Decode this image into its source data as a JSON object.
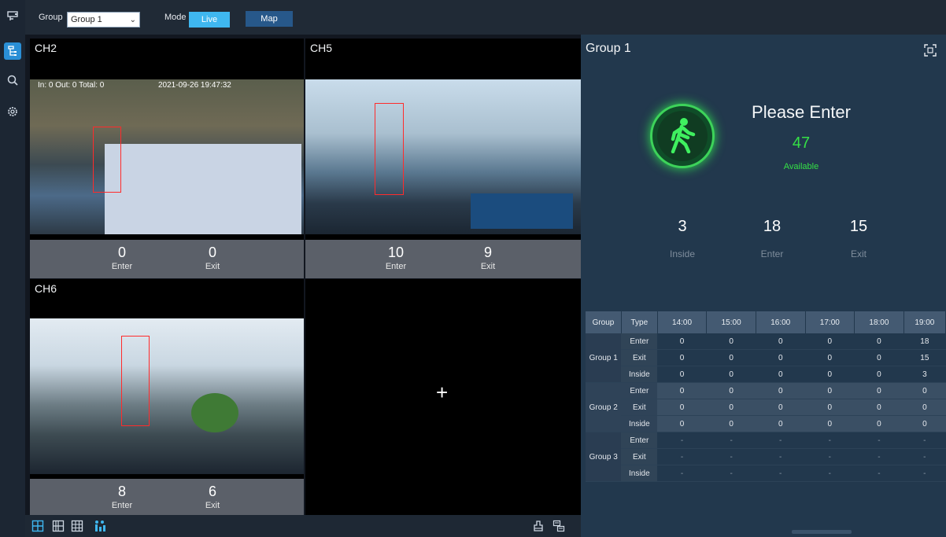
{
  "topbar": {
    "group_label": "Group",
    "group_value": "Group 1",
    "mode_label": "Mode",
    "mode_live": "Live",
    "mode_map": "Map"
  },
  "sidebar": {
    "items": [
      {
        "icon": "live-view-icon"
      },
      {
        "icon": "people-counting-icon"
      },
      {
        "icon": "search-icon"
      },
      {
        "icon": "settings-icon"
      }
    ]
  },
  "tiles": [
    {
      "title": "CH2",
      "osd": "In:  0  Out:  0  Total:  0",
      "osd_time": "2021-09-26 19:47:32",
      "enter": "0",
      "exit": "0",
      "enter_label": "Enter",
      "exit_label": "Exit"
    },
    {
      "title": "CH5",
      "enter": "10",
      "exit": "9",
      "enter_label": "Enter",
      "exit_label": "Exit"
    },
    {
      "title": "CH6",
      "enter": "8",
      "exit": "6",
      "enter_label": "Enter",
      "exit_label": "Exit"
    }
  ],
  "empty_tile_symbol": "+",
  "panel": {
    "title": "Group 1",
    "status": "Please Enter",
    "available": "47",
    "available_label": "Available",
    "stats": [
      {
        "value": "3",
        "label": "Inside"
      },
      {
        "value": "18",
        "label": "Enter"
      },
      {
        "value": "15",
        "label": "Exit"
      }
    ]
  },
  "table": {
    "headers": [
      "Group",
      "Type",
      "14:00",
      "15:00",
      "16:00",
      "17:00",
      "18:00",
      "19:00"
    ],
    "groups": [
      {
        "name": "Group 1",
        "rows": [
          {
            "type": "Enter",
            "values": [
              "0",
              "0",
              "0",
              "0",
              "0",
              "18"
            ]
          },
          {
            "type": "Exit",
            "values": [
              "0",
              "0",
              "0",
              "0",
              "0",
              "15"
            ]
          },
          {
            "type": "Inside",
            "values": [
              "0",
              "0",
              "0",
              "0",
              "0",
              "3"
            ]
          }
        ]
      },
      {
        "name": "Group 2",
        "rows": [
          {
            "type": "Enter",
            "values": [
              "0",
              "0",
              "0",
              "0",
              "0",
              "0"
            ]
          },
          {
            "type": "Exit",
            "values": [
              "0",
              "0",
              "0",
              "0",
              "0",
              "0"
            ]
          },
          {
            "type": "Inside",
            "values": [
              "0",
              "0",
              "0",
              "0",
              "0",
              "0"
            ]
          }
        ]
      },
      {
        "name": "Group 3",
        "rows": [
          {
            "type": "Enter",
            "values": [
              "-",
              "-",
              "-",
              "-",
              "-",
              "-"
            ]
          },
          {
            "type": "Exit",
            "values": [
              "-",
              "-",
              "-",
              "-",
              "-",
              "-"
            ]
          },
          {
            "type": "Inside",
            "values": [
              "-",
              "-",
              "-",
              "-",
              "-",
              "-"
            ]
          }
        ]
      }
    ]
  },
  "colors": {
    "accent": "#3fb7f0",
    "available_green": "#35e046",
    "panel_bg": "#22384d"
  }
}
